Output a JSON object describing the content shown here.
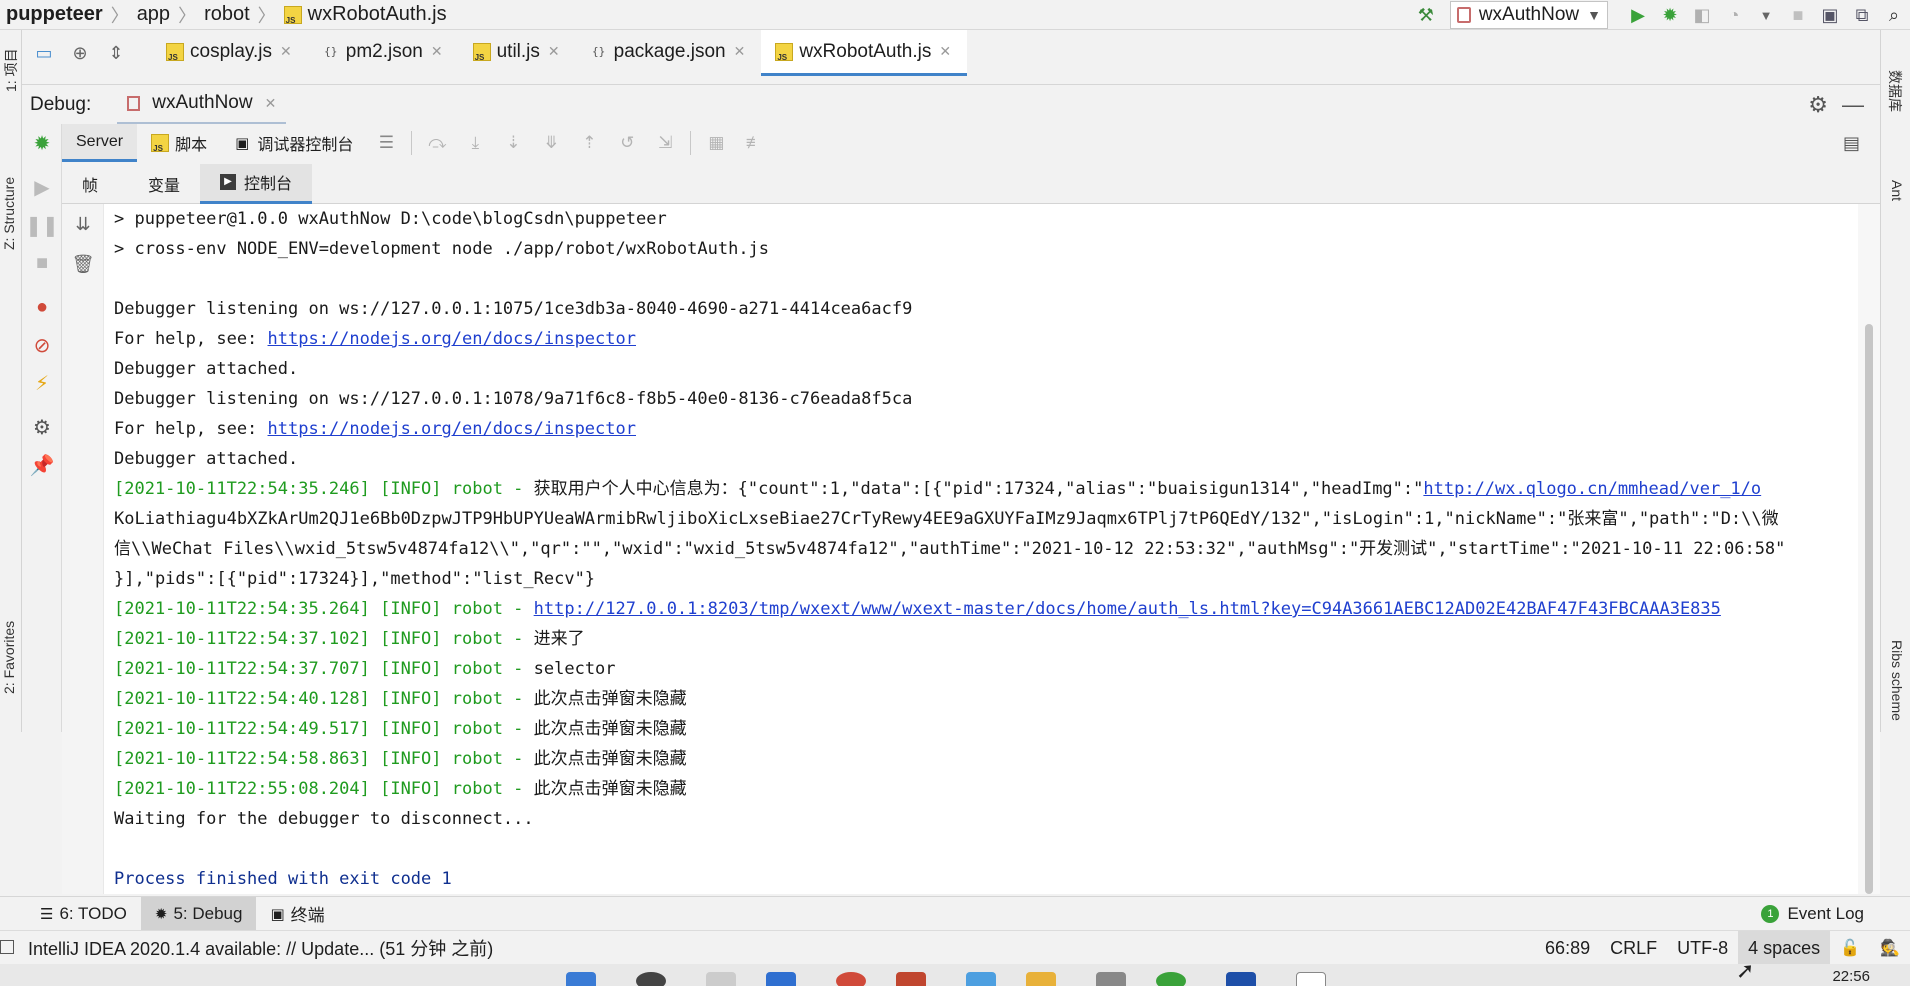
{
  "breadcrumb": {
    "items": [
      "puppeteer",
      "app",
      "robot",
      "wxRobotAuth.js"
    ]
  },
  "run_config": {
    "name": "wxAuthNow"
  },
  "left_stripe": {
    "project": "1: 项目",
    "structure": "Z: Structure",
    "favorites": "2: Favorites"
  },
  "right_stripe": {
    "database": "数据库",
    "ant": "Ant",
    "ribs": "Ribs scheme"
  },
  "editor_tabs": [
    {
      "label": "cosplay.js",
      "type": "js"
    },
    {
      "label": "pm2.json",
      "type": "json"
    },
    {
      "label": "util.js",
      "type": "js"
    },
    {
      "label": "package.json",
      "type": "json"
    },
    {
      "label": "wxRobotAuth.js",
      "type": "js",
      "active": true
    }
  ],
  "debug": {
    "title": "Debug:",
    "session": "wxAuthNow"
  },
  "debug_tabs": {
    "server": "Server",
    "script": "脚本",
    "console": "调试器控制台"
  },
  "sub_tabs": {
    "frames": "帧",
    "variables": "变量",
    "console": "控制台"
  },
  "console_lines": [
    {
      "text": "> puppeteer@1.0.0 wxAuthNow D:\\code\\blogCsdn\\puppeteer"
    },
    {
      "text": "> cross-env NODE_ENV=development node ./app/robot/wxRobotAuth.js"
    },
    {
      "text": ""
    },
    {
      "text": "Debugger listening on ws://127.0.0.1:1075/1ce3db3a-8040-4690-a271-4414cea6acf9"
    },
    {
      "prefix": "For help, see: ",
      "link": "https://nodejs.org/en/docs/inspector"
    },
    {
      "text": "Debugger attached."
    },
    {
      "text": "Debugger listening on ws://127.0.0.1:1078/9a71f6c8-f8b5-40e0-8136-c76eada8f5ca"
    },
    {
      "prefix": "For help, see: ",
      "link": "https://nodejs.org/en/docs/inspector"
    },
    {
      "text": "Debugger attached."
    },
    {
      "green": "[2021-10-11T22:54:35.246] [INFO] robot - ",
      "text": "获取用户个人中心信息为：{\"count\":1,\"data\":[{\"pid\":17324,\"alias\":\"buaisigun1314\",\"headImg\":\"",
      "link": "http://wx.qlogo.cn/mmhead/ver_1/o"
    },
    {
      "text": "KoLiathiagu4bXZkArUm2QJ1e6Bb0DzpwJTP9HbUPYUeaWArmibRwljiboXicLxseBiae27CrTyRewy4EE9aGXUYFaIMz9Jaqmx6TPlj7tP6QEdY/132\",\"isLogin\":1,\"nickName\":\"张来富\",\"path\":\"D:\\\\微"
    },
    {
      "text": "信\\\\WeChat Files\\\\wxid_5tsw5v4874fa12\\\\\",\"qr\":\"\",\"wxid\":\"wxid_5tsw5v4874fa12\",\"authTime\":\"2021-10-12 22:53:32\",\"authMsg\":\"开发测试\",\"startTime\":\"2021-10-11 22:06:58\""
    },
    {
      "text": "}],\"pids\":[{\"pid\":17324}],\"method\":\"list_Recv\"}"
    },
    {
      "green": "[2021-10-11T22:54:35.264] [INFO] robot - ",
      "link": "http://127.0.0.1:8203/tmp/wxext/www/wxext-master/docs/home/auth_ls.html?key=C94A3661AEBC12AD02E42BAF47F43FBCAAA3E835"
    },
    {
      "green": "[2021-10-11T22:54:37.102] [INFO] robot - ",
      "text": "进来了"
    },
    {
      "green": "[2021-10-11T22:54:37.707] [INFO] robot - ",
      "text": "selector"
    },
    {
      "green": "[2021-10-11T22:54:40.128] [INFO] robot - ",
      "text": "此次点击弹窗未隐藏"
    },
    {
      "green": "[2021-10-11T22:54:49.517] [INFO] robot - ",
      "text": "此次点击弹窗未隐藏"
    },
    {
      "green": "[2021-10-11T22:54:58.863] [INFO] robot - ",
      "text": "此次点击弹窗未隐藏"
    },
    {
      "green": "[2021-10-11T22:55:08.204] [INFO] robot - ",
      "text": "此次点击弹窗未隐藏"
    },
    {
      "text": "Waiting for the debugger to disconnect..."
    },
    {
      "text": ""
    },
    {
      "blue": "Process finished with exit code 1"
    }
  ],
  "bottom_tools": {
    "todo": "6: TODO",
    "debug": "5: Debug",
    "terminal": "终端",
    "event_log": "Event Log",
    "event_count": "1"
  },
  "status": {
    "message": "IntelliJ IDEA 2020.1.4 available: // Update... (51 分钟 之前)",
    "position": "66:89",
    "line_ending": "CRLF",
    "encoding": "UTF-8",
    "indent": "4 spaces"
  },
  "taskbar": {
    "clock": "22:56"
  },
  "colors": {
    "log_green": "#1f9b1f",
    "link_blue": "#1f3fcf",
    "exit_blue": "#0f2f8f",
    "active_tab": "#4083c9"
  }
}
